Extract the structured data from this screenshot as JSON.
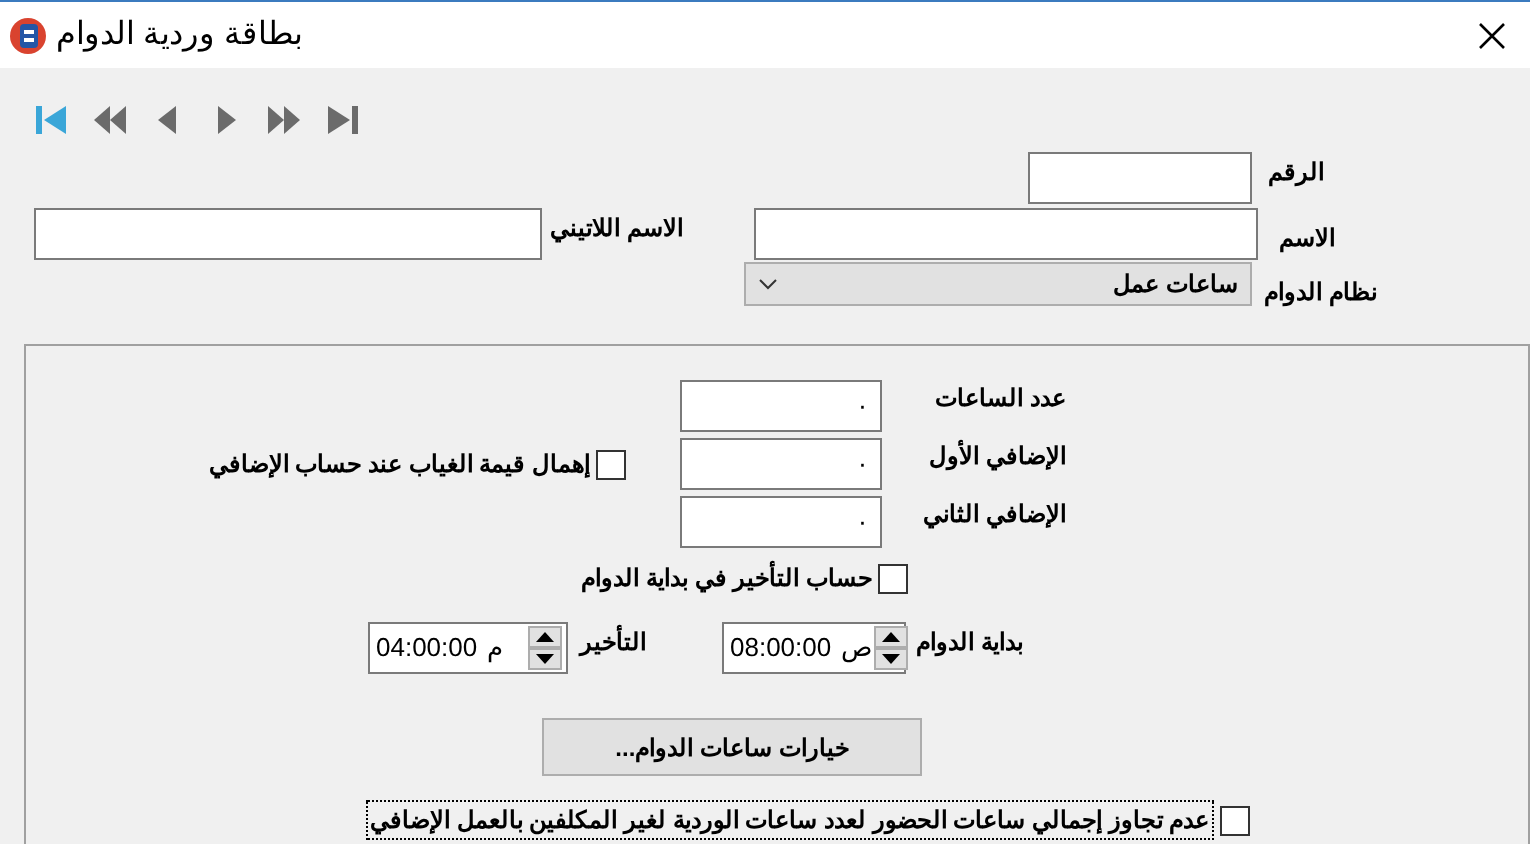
{
  "window": {
    "title": "بطاقة وردية الدوام"
  },
  "navigation": [
    {
      "kind": "first",
      "highlighted": true
    },
    {
      "kind": "prev_page",
      "highlighted": false
    },
    {
      "kind": "prev",
      "highlighted": false
    },
    {
      "kind": "next",
      "highlighted": false
    },
    {
      "kind": "next_page",
      "highlighted": false
    },
    {
      "kind": "last",
      "highlighted": false
    }
  ],
  "number": {
    "label": "الرقم"
  },
  "name": {
    "label": "الاسم"
  },
  "latin_name": {
    "label": "الاسم اللاتيني"
  },
  "work_system": {
    "label": "نظام الدوام",
    "value": "ساعات عمل"
  },
  "hours_fields": [
    {
      "label": "عدد الساعات",
      "value": "٠"
    },
    {
      "label": "الإضافي الأول",
      "value": "٠"
    },
    {
      "label": "الإضافي الثاني",
      "value": "٠"
    }
  ],
  "ignore_absence": {
    "label": "إهمال قيمة الغياب عند حساب الإضافي",
    "checked": false
  },
  "late_calc": {
    "label": "حساب التأخير في بداية الدوام",
    "checked": false
  },
  "start_time": {
    "label": "بداية الدوام",
    "value": "08:00:00",
    "period": "ص"
  },
  "delay_time": {
    "label": "التأخير",
    "value": "04:00:00",
    "period": "م"
  },
  "options_button": "خيارات ساعات الدوام...",
  "no_exceed": {
    "label": "عدم تجاوز  إجمالي ساعات الحضور لعدد ساعات الوردية لغير المكلفين بالعمل الإضافي",
    "checked": false,
    "focused": true
  }
}
